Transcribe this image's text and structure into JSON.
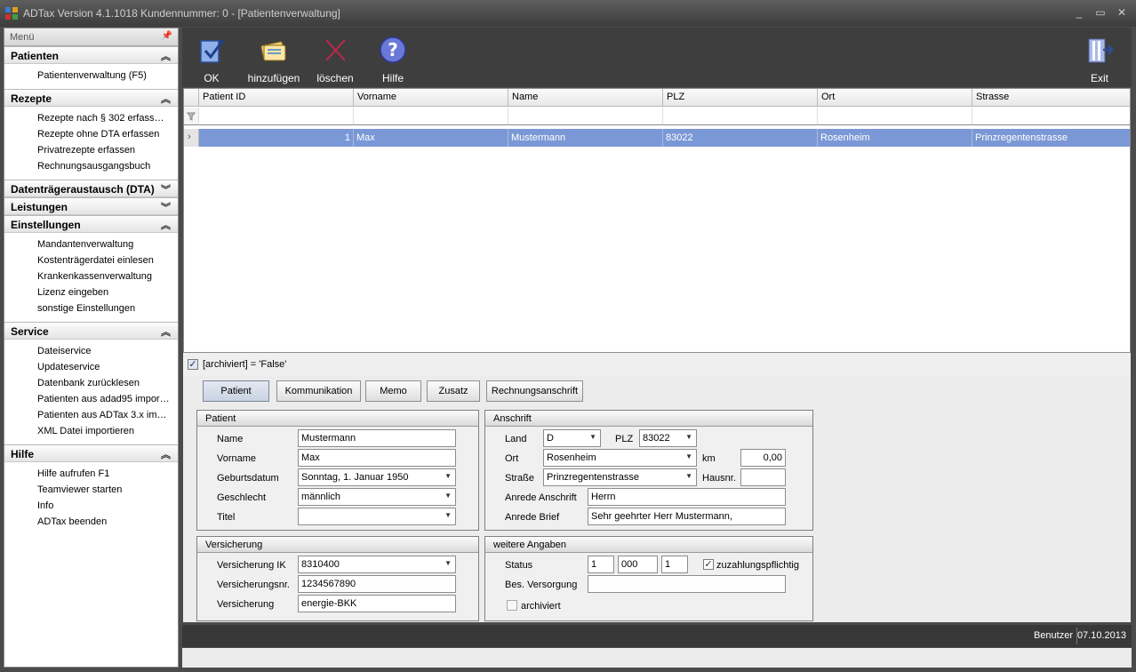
{
  "window": {
    "title": "ADTax  Version 4.1.1018  Kundennummer: 0 - [Patientenverwaltung]",
    "min": "_",
    "max": "▭",
    "close": "✕"
  },
  "sidebar": {
    "title": "Menü",
    "groups": [
      {
        "title": "Patienten",
        "items": [
          "Patientenverwaltung (F5)"
        ]
      },
      {
        "title": "Rezepte",
        "items": [
          "Rezepte nach § 302 erfass…",
          "Rezepte ohne DTA erfassen",
          "Privatrezepte erfassen",
          "Rechnungsausgangsbuch"
        ]
      },
      {
        "title": "Datenträgeraustausch (DTA)",
        "items": []
      },
      {
        "title": "Leistungen",
        "items": []
      },
      {
        "title": "Einstellungen",
        "items": [
          "Mandantenverwaltung",
          "Kostenträgerdatei einlesen",
          "Krankenkassenverwaltung",
          "Lizenz eingeben",
          "sonstige Einstellungen"
        ]
      },
      {
        "title": "Service",
        "items": [
          "Dateiservice",
          "Updateservice",
          "Datenbank zurücklesen",
          "Patienten aus adad95 impor…",
          "Patienten aus ADTax 3.x im…",
          "XML Datei  importieren"
        ]
      },
      {
        "title": "Hilfe",
        "items": [
          "Hilfe aufrufen F1",
          "Teamviewer starten",
          "Info",
          "ADTax beenden"
        ]
      }
    ]
  },
  "toolbar": {
    "ok": "OK",
    "add": "hinzufügen",
    "delete": "löschen",
    "help": "Hilfe",
    "exit": "Exit"
  },
  "grid": {
    "columns": [
      "Patient ID",
      "Vorname",
      "Name",
      "PLZ",
      "Ort",
      "Strasse"
    ],
    "row": [
      "1",
      "Max",
      "Mustermann",
      "83022",
      "Rosenheim",
      "Prinzregentenstrasse"
    ],
    "filter": "[archiviert] = 'False'",
    "filter_checked": "✓"
  },
  "tabs": [
    "Patient",
    "Kommunikation",
    "Memo",
    "Zusatz",
    "Rechnungsanschrift"
  ],
  "patient": {
    "title": "Patient",
    "name_label": "Name",
    "name": "Mustermann",
    "vorname_label": "Vorname",
    "vorname": "Max",
    "geburt_label": "Geburtsdatum",
    "geburt": "Sonntag, 1. Januar 1950",
    "geschlecht_label": "Geschlecht",
    "geschlecht": "männlich",
    "titel_label": "Titel",
    "titel": ""
  },
  "anschrift": {
    "title": "Anschrift",
    "land_label": "Land",
    "land": "D",
    "plz_label": "PLZ",
    "plz": "83022",
    "ort_label": "Ort",
    "ort": "Rosenheim",
    "km_label": "km",
    "km": "0,00",
    "strasse_label": "Straße",
    "strasse": "Prinzregentenstrasse",
    "hausnr_label": "Hausnr.",
    "hausnr": "",
    "anrede_anschrift_label": "Anrede Anschrift",
    "anrede_anschrift": "Herrn",
    "anrede_brief_label": "Anrede Brief",
    "anrede_brief": "Sehr geehrter Herr Mustermann,"
  },
  "versicherung": {
    "title": "Versicherung",
    "ik_label": "Versicherung IK",
    "ik": "8310400",
    "nr_label": "Versicherungsnr.",
    "nr": "1234567890",
    "vers_label": "Versicherung",
    "vers": "energie-BKK"
  },
  "weitere": {
    "title": "weitere Angaben",
    "status_label": "Status",
    "status1": "1",
    "status2": "000",
    "status3": "1",
    "zuz_label": "zuzahlungspflichtig",
    "zuz_checked": "✓",
    "bes_label": "Bes. Versorgung",
    "bes": "",
    "archiviert_label": "archiviert"
  },
  "status": {
    "user": "Benutzer",
    "date": "07.10.2013"
  }
}
